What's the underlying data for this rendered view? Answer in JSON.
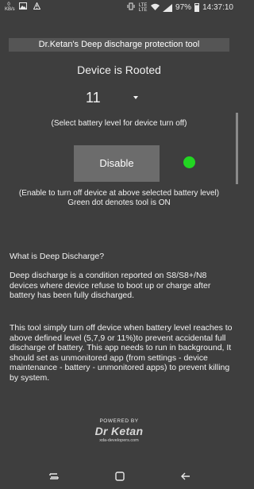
{
  "status_bar": {
    "speed": "0\nKB/s",
    "network": "LTE\nLTE",
    "battery_percent": "97%",
    "time": "14:37:10"
  },
  "header": {
    "title": "Dr.Ketan's Deep discharge protection tool"
  },
  "device_status": "Device is Rooted",
  "battery_select": {
    "value": "11"
  },
  "hint_select": "(Select battery level for device turn off)",
  "disable_button": {
    "label": "Disable"
  },
  "tool_status": {
    "color": "#22d622"
  },
  "hint_enable": "(Enable to turn off device at above selected battery level)\nGreen dot denotes tool is ON",
  "info": {
    "title": "What is Deep Discharge?",
    "paragraph1": "Deep discharge is a condition reported on S8/S8+/N8 devices where device refuse to boot up or charge after battery has been fully discharged.",
    "paragraph2": "This tool simply turn off device when battery level reaches to above defined level (5,7,9 or 11%)to prevent accidental full discharge of battery. This app needs to run in background, It should set as unmonitored app (from settings - device maintenance - battery - unmonitored apps) to prevent killing by system."
  },
  "branding": {
    "powered_by": "POWERED BY",
    "name": "Dr Ketan",
    "site": "xda-developers.com"
  },
  "nav_icons": [
    "recents-icon",
    "home-icon",
    "back-icon"
  ]
}
